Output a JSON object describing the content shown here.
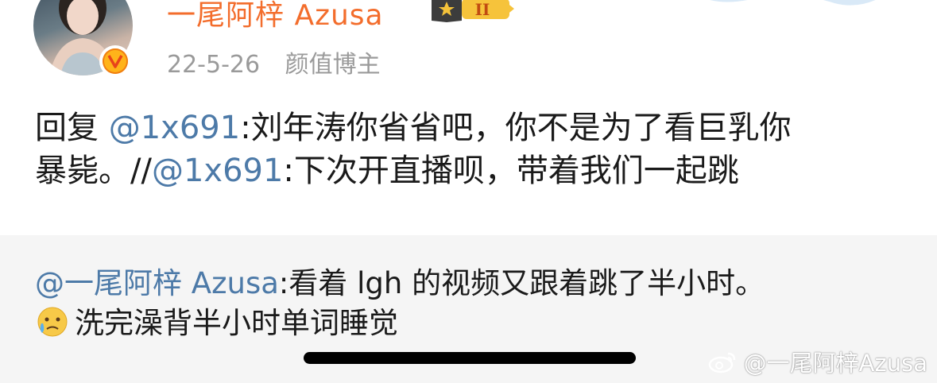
{
  "author": {
    "name": "一尾阿梓 Azusa",
    "verified_mark": "V",
    "level_badge_text": "II",
    "date": "22-5-26",
    "tag": "颜值博主"
  },
  "post": {
    "line1_prefix": "回复 ",
    "line1_mention": "@1x691",
    "line1_rest": ":刘年涛你省省吧，你不是为了看巨乳你",
    "line2_prefix": "暴毙。//",
    "line2_mention": "@1x691",
    "line2_rest": ":下次开直播呗，带着我们一起跳"
  },
  "repost": {
    "mention": "@一尾阿梓 Azusa",
    "line1_rest": ":看着 lgh 的视频又跟着跳了半小时。",
    "emoji_icon": "crying-face-emoji",
    "line2_rest": "洗完澡背半小时单词睡觉"
  },
  "watermark": {
    "icon": "weibo-logo-icon",
    "text": "@一尾阿梓Azusa"
  },
  "colors": {
    "username": "#f36d2c",
    "mention": "#4d7aa8",
    "meta": "#9a9a9a",
    "repost_bg": "#f5f5f5"
  }
}
